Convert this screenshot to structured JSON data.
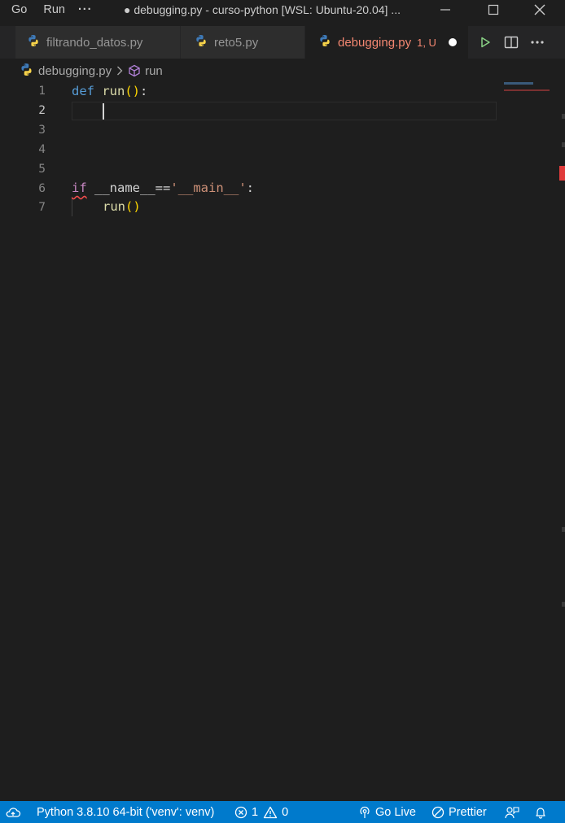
{
  "titlebar": {
    "menu": [
      "Go",
      "Run"
    ],
    "more": "···",
    "title": "● debugging.py - curso-python [WSL: Ubuntu-20.04] ..."
  },
  "tabs": [
    {
      "label": "filtrando_datos.py",
      "icon": "python-icon",
      "active": false
    },
    {
      "label": "reto5.py",
      "icon": "python-icon",
      "active": false
    },
    {
      "label": "debugging.py",
      "icon": "python-icon",
      "active": true,
      "badge": "1, U",
      "modified": true
    }
  ],
  "breadcrumb": {
    "file": "debugging.py",
    "symbol": "run"
  },
  "editor": {
    "line_numbers": [
      "1",
      "2",
      "3",
      "4",
      "5",
      "6",
      "7"
    ],
    "current_line": 2,
    "lines": {
      "l1_kw": "def",
      "l1_fn": "run",
      "l1_parens": "()",
      "l1_colon": ":",
      "l6_kw": "if",
      "l6_mid": " __name__==",
      "l6_str": "'__main__'",
      "l6_colon": ":",
      "l7_fn": "run",
      "l7_parens": "()"
    }
  },
  "statusbar": {
    "python": "Python 3.8.10 64-bit ('venv': venv)",
    "errors": "1",
    "warnings": "0",
    "golive": "Go Live",
    "prettier": "Prettier"
  },
  "colors": {
    "statusbar": "#007acc",
    "editor_bg": "#1e1e1e",
    "tab_modified": "#f48771"
  }
}
